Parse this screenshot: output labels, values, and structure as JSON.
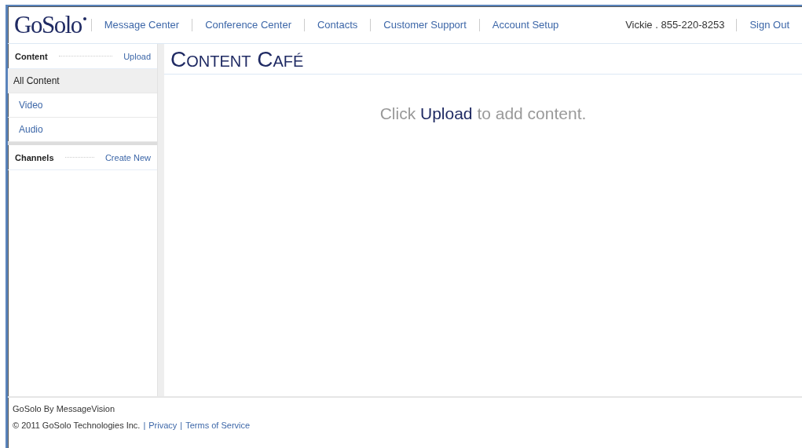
{
  "header": {
    "logo": "GoSolo",
    "nav": [
      "Message Center",
      "Conference Center",
      "Contacts",
      "Customer Support",
      "Account Setup"
    ],
    "user": "Vickie . 855-220-8253",
    "sign_out": "Sign Out"
  },
  "sidebar": {
    "sections": [
      {
        "title": "Content",
        "action": "Upload",
        "items": [
          {
            "label": "All Content",
            "selected": true,
            "indented": false
          },
          {
            "label": "Video",
            "selected": false,
            "indented": true
          },
          {
            "label": "Audio",
            "selected": false,
            "indented": true
          }
        ]
      },
      {
        "title": "Channels",
        "action": "Create New"
      }
    ]
  },
  "main": {
    "title": "Content Café",
    "empty_message": {
      "prefix": "Click",
      "link": "Upload",
      "suffix": "to add content."
    }
  },
  "footer": {
    "brand": "GoSolo By MessageVision",
    "copyright": "© 2011 GoSolo Technologies Inc.",
    "links": [
      {
        "separator": "|",
        "label": "Privacy"
      },
      {
        "separator": "|",
        "label": "Terms of Service"
      }
    ]
  }
}
